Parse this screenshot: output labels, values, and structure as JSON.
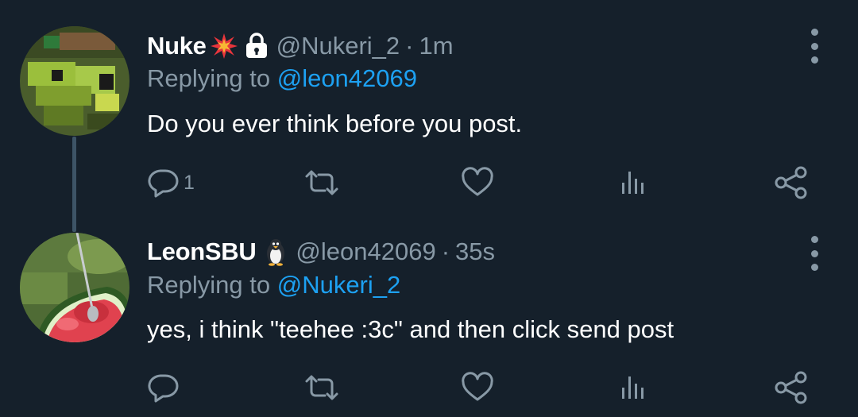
{
  "tweets": [
    {
      "name": "Nuke",
      "badge_emojis": [
        "collision-emoji",
        "lock-icon"
      ],
      "handle": "@Nukeri_2",
      "separator": "·",
      "time": "1m",
      "replying_prefix": "Replying to ",
      "replying_to": "@leon42069",
      "text": "Do you ever think before you post.",
      "reply_count": "1"
    },
    {
      "name": "LeonSBU",
      "badge_emojis": [
        "penguin-emoji"
      ],
      "handle": "@leon42069",
      "separator": "·",
      "time": "35s",
      "replying_prefix": "Replying to ",
      "replying_to": "@Nukeri_2",
      "text": "yes, i think \"teehee :3c\" and then click send post",
      "reply_count": ""
    }
  ],
  "colors": {
    "background": "#15202b",
    "secondary_text": "#8899a6",
    "link": "#1da1f2",
    "thread_line": "#3d5466"
  },
  "action_icons": [
    "reply-icon",
    "retweet-icon",
    "like-icon",
    "views-icon",
    "share-icon"
  ]
}
